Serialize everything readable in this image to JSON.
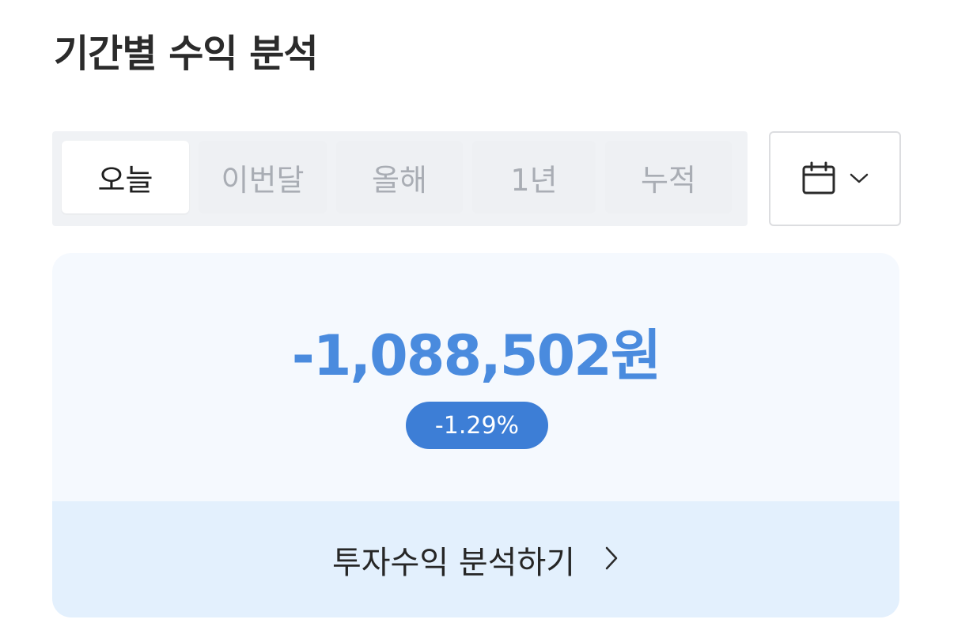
{
  "header": {
    "title": "기간별 수익 분석"
  },
  "period_tabs": [
    {
      "label": "오늘",
      "active": true
    },
    {
      "label": "이번달",
      "active": false
    },
    {
      "label": "올해",
      "active": false
    },
    {
      "label": "1년",
      "active": false
    },
    {
      "label": "누적",
      "active": false
    }
  ],
  "date_picker": {
    "icon": "calendar-icon",
    "dropdown_icon": "chevron-down-icon"
  },
  "summary": {
    "amount": "-1,088,502원",
    "rate": "-1.29%",
    "link_label": "투자수익 분석하기",
    "link_icon": "chevron-right-icon"
  },
  "colors": {
    "amount": "#4a8bde",
    "badge_background": "#3d7ed6",
    "card_background": "#f5f9fe",
    "link_background": "#e3f0fd",
    "tab_group_background": "#f0f2f5"
  }
}
